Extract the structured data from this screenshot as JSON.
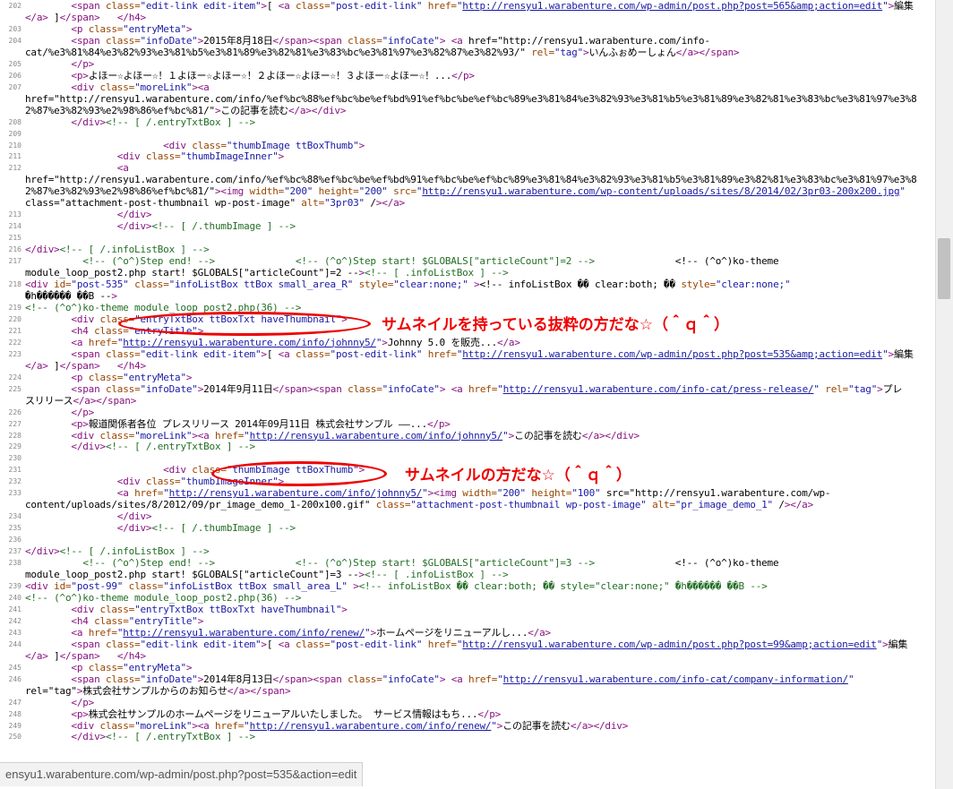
{
  "lines": [
    {
      "n": "202",
      "t": "        <span class=\"edit-link edit-item\">[ <a class=\"post-edit-link\" href=\"http://rensyu1.warabenture.com/wp-admin/post.php?post=565&amp;action=edit\">編集"
    },
    {
      "n": "",
      "t": "</a> ]</span>   </h4>"
    },
    {
      "n": "203",
      "t": "        <p class=\"entryMeta\">"
    },
    {
      "n": "204",
      "t": "        <span class=\"infoDate\">2015年8月18日</span><span class=\"infoCate\"> <a href=\"http://rensyu1.warabenture.com/info-"
    },
    {
      "n": "",
      "t": "cat/%e3%81%84%e3%82%93%e3%81%b5%e3%81%89%e3%82%81%e3%83%bc%e3%81%97%e3%82%87%e3%82%93/\" rel=\"tag\">いんふぉめーしょん</a></span>"
    },
    {
      "n": "205",
      "t": "        </p>"
    },
    {
      "n": "206",
      "t": "        <p>よほー☆よほー☆！１よほー☆よほー☆！２よほー☆よほー☆！３よほー☆よほー☆！...</p>"
    },
    {
      "n": "207",
      "t": "        <div class=\"moreLink\"><a"
    },
    {
      "n": "",
      "t": "href=\"http://rensyu1.warabenture.com/info/%ef%bc%88%ef%bc%be%ef%bd%91%ef%bc%be%ef%bc%89%e3%81%84%e3%82%93%e3%81%b5%e3%81%89%e3%82%81%e3%83%bc%e3%81%97%e3%8"
    },
    {
      "n": "",
      "t": "2%87%e3%82%93%e2%98%86%ef%bc%81/\">この記事を読む</a></div>"
    },
    {
      "n": "208",
      "t": "        </div><!-- [ /.entryTxtBox ] -->"
    },
    {
      "n": "209",
      "t": ""
    },
    {
      "n": "210",
      "t": "                        <div class=\"thumbImage ttBoxThumb\">"
    },
    {
      "n": "211",
      "t": "                <div class=\"thumbImageInner\">"
    },
    {
      "n": "212",
      "t": "                <a"
    },
    {
      "n": "",
      "t": "href=\"http://rensyu1.warabenture.com/info/%ef%bc%88%ef%bc%be%ef%bd%91%ef%bc%be%ef%bc%89%e3%81%84%e3%82%93%e3%81%b5%e3%81%89%e3%82%81%e3%83%bc%e3%81%97%e3%8"
    },
    {
      "n": "",
      "t": "2%87%e3%82%93%e2%98%86%ef%bc%81/\"><img width=\"200\" height=\"200\" src=\"http://rensyu1.warabenture.com/wp-content/uploads/sites/8/2014/02/3pr03-200x200.jpg\""
    },
    {
      "n": "",
      "t": "class=\"attachment-post-thumbnail wp-post-image\" alt=\"3pr03\" /></a>"
    },
    {
      "n": "213",
      "t": "                </div>"
    },
    {
      "n": "214",
      "t": "                </div><!-- [ /.thumbImage ] -->"
    },
    {
      "n": "215",
      "t": ""
    },
    {
      "n": "216",
      "t": "</div><!-- [ /.infoListBox ] -->"
    },
    {
      "n": "217",
      "t": "          <!-- (^o^)Step end! -->              <!-- (^o^)Step start! $GLOBALS[\"articleCount\"]=2 -->              <!-- (^o^)ko-theme"
    },
    {
      "n": "",
      "t": "module_loop_post2.php start! $GLOBALS[\"articleCount\"]=2 --><!-- [ .infoListBox ] -->"
    },
    {
      "n": "218",
      "t": "<div id=\"post-535\" class=\"infoListBox ttBox small_area_R\" style=\"clear:none;\" ><!-- infoListBox �� clear:both; �� style=\"clear:none;\""
    },
    {
      "n": "",
      "t": "�h������ ��B -->"
    },
    {
      "n": "219",
      "t": "<!-- (^o^)ko-theme module_loop_post2.php(36) -->"
    },
    {
      "n": "220",
      "t": "        <div class=\"entryTxtBox ttBoxTxt haveThumbnail\">"
    },
    {
      "n": "221",
      "t": "        <h4 class=\"entryTitle\">"
    },
    {
      "n": "222",
      "t": "        <a href=\"http://rensyu1.warabenture.com/info/johnny5/\">Johnny 5.0 を販売...</a>"
    },
    {
      "n": "223",
      "t": "        <span class=\"edit-link edit-item\">[ <a class=\"post-edit-link\" href=\"http://rensyu1.warabenture.com/wp-admin/post.php?post=535&amp;action=edit\">編集"
    },
    {
      "n": "",
      "t": "</a> ]</span>   </h4>"
    },
    {
      "n": "224",
      "t": "        <p class=\"entryMeta\">"
    },
    {
      "n": "225",
      "t": "        <span class=\"infoDate\">2014年9月11日</span><span class=\"infoCate\"> <a href=\"http://rensyu1.warabenture.com/info-cat/press-release/\" rel=\"tag\">プレ"
    },
    {
      "n": "",
      "t": "スリリース</a></span>"
    },
    {
      "n": "226",
      "t": "        </p>"
    },
    {
      "n": "227",
      "t": "        <p>報道関係者各位 プレスリリース 2014年09月11日 株式会社サンプル ――...</p>"
    },
    {
      "n": "228",
      "t": "        <div class=\"moreLink\"><a href=\"http://rensyu1.warabenture.com/info/johnny5/\">この記事を読む</a></div>"
    },
    {
      "n": "229",
      "t": "        </div><!-- [ /.entryTxtBox ] -->"
    },
    {
      "n": "230",
      "t": ""
    },
    {
      "n": "231",
      "t": "                        <div class=\"thumbImage ttBoxThumb\">"
    },
    {
      "n": "232",
      "t": "                <div class=\"thumbImageInner\">"
    },
    {
      "n": "233",
      "t": "                <a href=\"http://rensyu1.warabenture.com/info/johnny5/\"><img width=\"200\" height=\"100\" src=\"http://rensyu1.warabenture.com/wp-"
    },
    {
      "n": "",
      "t": "content/uploads/sites/8/2012/09/pr_image_demo_1-200x100.gif\" class=\"attachment-post-thumbnail wp-post-image\" alt=\"pr_image_demo_1\" /></a>"
    },
    {
      "n": "234",
      "t": "                </div>"
    },
    {
      "n": "235",
      "t": "                </div><!-- [ /.thumbImage ] -->"
    },
    {
      "n": "236",
      "t": ""
    },
    {
      "n": "237",
      "t": "</div><!-- [ /.infoListBox ] -->"
    },
    {
      "n": "238",
      "t": "          <!-- (^o^)Step end! -->              <!-- (^o^)Step start! $GLOBALS[\"articleCount\"]=3 -->              <!-- (^o^)ko-theme"
    },
    {
      "n": "",
      "t": "module_loop_post2.php start! $GLOBALS[\"articleCount\"]=3 --><!-- [ .infoListBox ] -->"
    },
    {
      "n": "239",
      "t": "<div id=\"post-99\" class=\"infoListBox ttBox small_area_L\" ><!-- infoListBox �� clear:both; �� style=\"clear:none;\" �h������ ��B -->"
    },
    {
      "n": "240",
      "t": "<!-- (^o^)ko-theme module_loop_post2.php(36) -->"
    },
    {
      "n": "241",
      "t": "        <div class=\"entryTxtBox ttBoxTxt haveThumbnail\">"
    },
    {
      "n": "242",
      "t": "        <h4 class=\"entryTitle\">"
    },
    {
      "n": "243",
      "t": "        <a href=\"http://rensyu1.warabenture.com/info/renew/\">ホームページをリニューアルし...</a>"
    },
    {
      "n": "244",
      "t": "        <span class=\"edit-link edit-item\">[ <a class=\"post-edit-link\" href=\"http://rensyu1.warabenture.com/wp-admin/post.php?post=99&amp;action=edit\">編集"
    },
    {
      "n": "",
      "t": "</a> ]</span>   </h4>"
    },
    {
      "n": "245",
      "t": "        <p class=\"entryMeta\">"
    },
    {
      "n": "246",
      "t": "        <span class=\"infoDate\">2014年8月13日</span><span class=\"infoCate\"> <a href=\"http://rensyu1.warabenture.com/info-cat/company-information/\""
    },
    {
      "n": "",
      "t": "rel=\"tag\">株式会社サンプルからのお知らせ</a></span>"
    },
    {
      "n": "247",
      "t": "        </p>"
    },
    {
      "n": "248",
      "t": "        <p>株式会社サンプルのホームページをリニューアルいたしました。 サービス情報はもち...</p>"
    },
    {
      "n": "249",
      "t": "        <div class=\"moreLink\"><a href=\"http://rensyu1.warabenture.com/info/renew/\">この記事を読む</a></div>"
    },
    {
      "n": "250",
      "t": "        </div><!-- [ /.entryTxtBox ] -->"
    }
  ],
  "annotations": [
    {
      "text": "サムネイルを持っている抜粋の方だな☆（＾ｑ＾）"
    },
    {
      "text": "サムネイルの方だな☆（＾ｑ＾）"
    }
  ],
  "status_bar": {
    "url": "ensyu1.warabenture.com/wp-admin/post.php?post=535&action=edit"
  }
}
